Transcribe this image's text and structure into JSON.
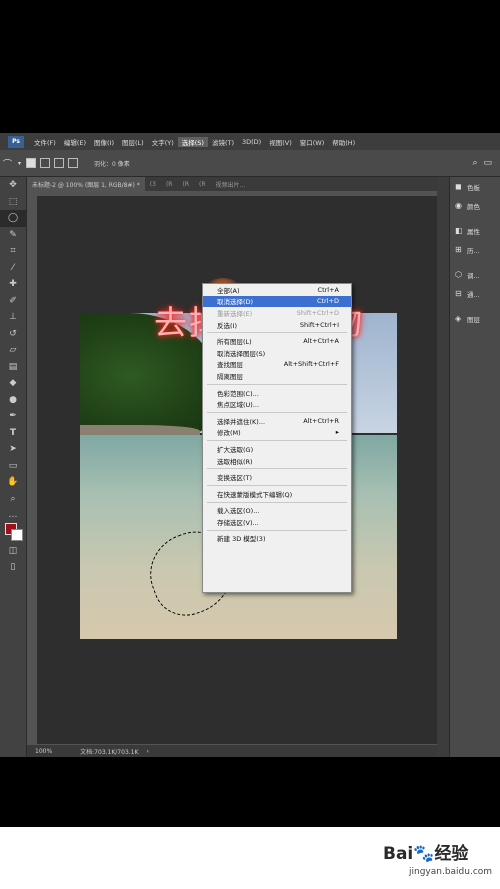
{
  "menubar": {
    "logo": "Ps",
    "items": [
      "文件(F)",
      "编辑(E)",
      "图像(I)",
      "图层(L)",
      "文字(Y)",
      "选择(S)",
      "滤镜(T)",
      "3D(D)",
      "视图(V)",
      "窗口(W)",
      "帮助(H)"
    ],
    "active_index": 5
  },
  "options": {
    "feather_label": "羽化：",
    "feather_value": "0 像素"
  },
  "tabs": [
    {
      "label": "未标题-2 @ 100% (图层 1, RGB/8#) *"
    },
    {
      "label": "(3"
    },
    {
      "label": "(R"
    },
    {
      "label": "(R"
    },
    {
      "label": "(R"
    },
    {
      "label": "视频出片..."
    }
  ],
  "overlay_title": "去掉多余人物",
  "select_menu": {
    "rows": [
      {
        "label": "全部(A)",
        "shortcut": "Ctrl+A",
        "state": "normal"
      },
      {
        "label": "取消选择(D)",
        "shortcut": "Ctrl+D",
        "state": "highlight"
      },
      {
        "label": "重新选择(E)",
        "shortcut": "Shift+Ctrl+D",
        "state": "disabled"
      },
      {
        "label": "反选(I)",
        "shortcut": "Shift+Ctrl+I",
        "state": "normal"
      },
      {
        "sep": true
      },
      {
        "label": "所有图层(L)",
        "shortcut": "Alt+Ctrl+A",
        "state": "normal"
      },
      {
        "label": "取消选择图层(S)",
        "shortcut": "",
        "state": "normal"
      },
      {
        "label": "查找图层",
        "shortcut": "Alt+Shift+Ctrl+F",
        "state": "normal"
      },
      {
        "label": "隔离图层",
        "shortcut": "",
        "state": "normal"
      },
      {
        "sep": true
      },
      {
        "label": "色彩范围(C)...",
        "shortcut": "",
        "state": "normal"
      },
      {
        "label": "焦点区域(U)...",
        "shortcut": "",
        "state": "normal"
      },
      {
        "sep": true
      },
      {
        "label": "选择并遮住(K)...",
        "shortcut": "Alt+Ctrl+R",
        "state": "normal"
      },
      {
        "label": "修改(M)",
        "shortcut": "▸",
        "state": "normal"
      },
      {
        "sep": true
      },
      {
        "label": "扩大选取(G)",
        "shortcut": "",
        "state": "normal"
      },
      {
        "label": "选取相似(R)",
        "shortcut": "",
        "state": "normal"
      },
      {
        "sep": true
      },
      {
        "label": "变换选区(T)",
        "shortcut": "",
        "state": "normal"
      },
      {
        "sep": true
      },
      {
        "label": "在快速蒙版模式下编辑(Q)",
        "shortcut": "",
        "state": "normal"
      },
      {
        "sep": true
      },
      {
        "label": "载入选区(O)...",
        "shortcut": "",
        "state": "normal"
      },
      {
        "label": "存储选区(V)...",
        "shortcut": "",
        "state": "normal"
      },
      {
        "sep": true
      },
      {
        "label": "新建 3D 模型(3)",
        "shortcut": "",
        "state": "normal"
      }
    ]
  },
  "panels": [
    {
      "icon": "color-panel-icon",
      "glyph": "◼",
      "label": "色板"
    },
    {
      "icon": "swatches-panel-icon",
      "glyph": "◉",
      "label": "颜色"
    },
    {
      "icon": "properties-panel-icon",
      "glyph": "◧",
      "label": "属性"
    },
    {
      "icon": "history-panel-icon",
      "glyph": "⊞",
      "label": "历..."
    },
    {
      "icon": "adjustments-panel-icon",
      "glyph": "⬡",
      "label": "调..."
    },
    {
      "icon": "channels-panel-icon",
      "glyph": "⊟",
      "label": "通..."
    },
    {
      "icon": "layers-panel-icon",
      "glyph": "◈",
      "label": "图层"
    }
  ],
  "status": {
    "zoom": "100%",
    "doc": "文档:703.1K/703.1K"
  },
  "watermark": {
    "brand": "Bai",
    "brand_suffix": "经验",
    "url": "jingyan.baidu.com"
  }
}
